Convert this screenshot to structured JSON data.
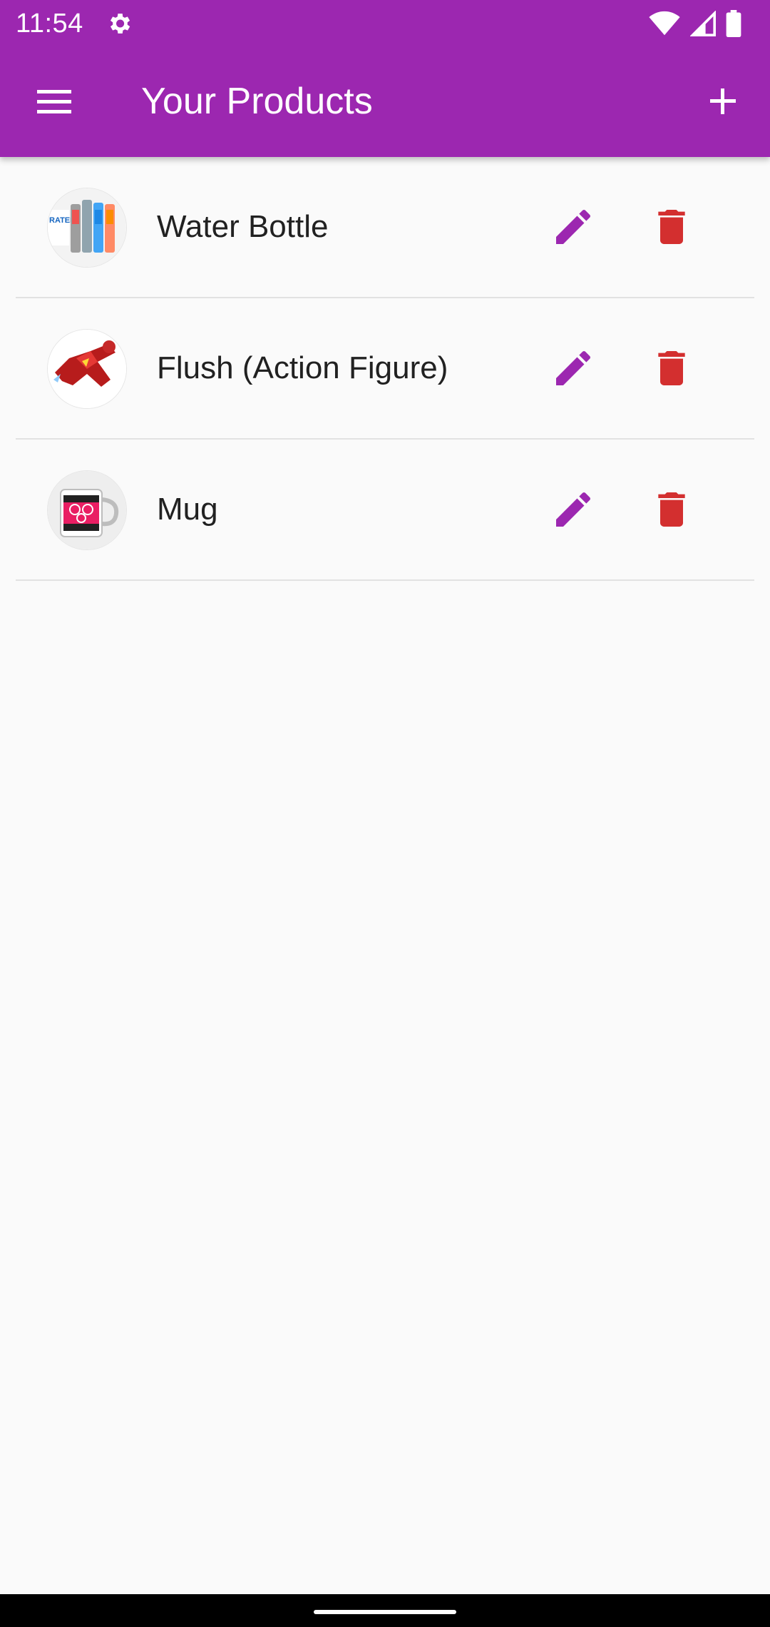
{
  "status_bar": {
    "time": "11:54",
    "icons": [
      "settings-icon",
      "wifi-icon",
      "signal-icon",
      "battery-icon"
    ]
  },
  "app_bar": {
    "title": "Your Products",
    "menu_icon": "hamburger-menu-icon",
    "add_icon": "plus-icon",
    "color": "#9c27b0"
  },
  "products": [
    {
      "name": "Water Bottle",
      "image": "water-bottle-thumbnail"
    },
    {
      "name": "Flush (Action Figure)",
      "image": "action-figure-thumbnail"
    },
    {
      "name": "Mug",
      "image": "mug-thumbnail"
    }
  ],
  "icons": {
    "edit": "pencil-icon",
    "delete": "trash-icon",
    "edit_color": "#9c27b0",
    "delete_color": "#d32f2f"
  }
}
